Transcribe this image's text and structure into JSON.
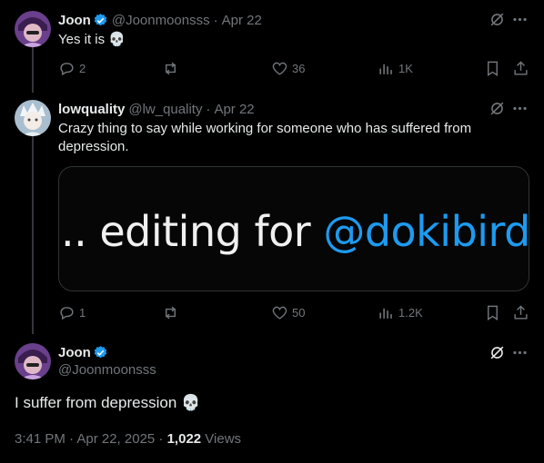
{
  "tweet1": {
    "name": "Joon",
    "handle": "@Joonmoonsss",
    "sep": "·",
    "date": "Apr 22",
    "text": "Yes it is 💀",
    "actions": {
      "replies": "2",
      "retweets": "",
      "likes": "36",
      "views": "1K"
    }
  },
  "tweet2": {
    "name": "lowquality",
    "handle": "@lw_quality",
    "sep": "·",
    "date": "Apr 22",
    "text": "Crazy thing to say while working for someone who has suffered from depression.",
    "media": {
      "prefix": ".. editing for ",
      "mention": "@dokibird"
    },
    "actions": {
      "replies": "1",
      "retweets": "",
      "likes": "50",
      "views": "1.2K"
    }
  },
  "main_tweet": {
    "name": "Joon",
    "handle": "@Joonmoonsss",
    "text": "I suffer from depression 💀",
    "time": "3:41 PM · Apr 22, 2025 · ",
    "views_count": "1,022",
    "views_label": " Views"
  },
  "colors": {
    "verified": "#1d9bf0",
    "muted": "#71767b",
    "line": "#333639"
  }
}
